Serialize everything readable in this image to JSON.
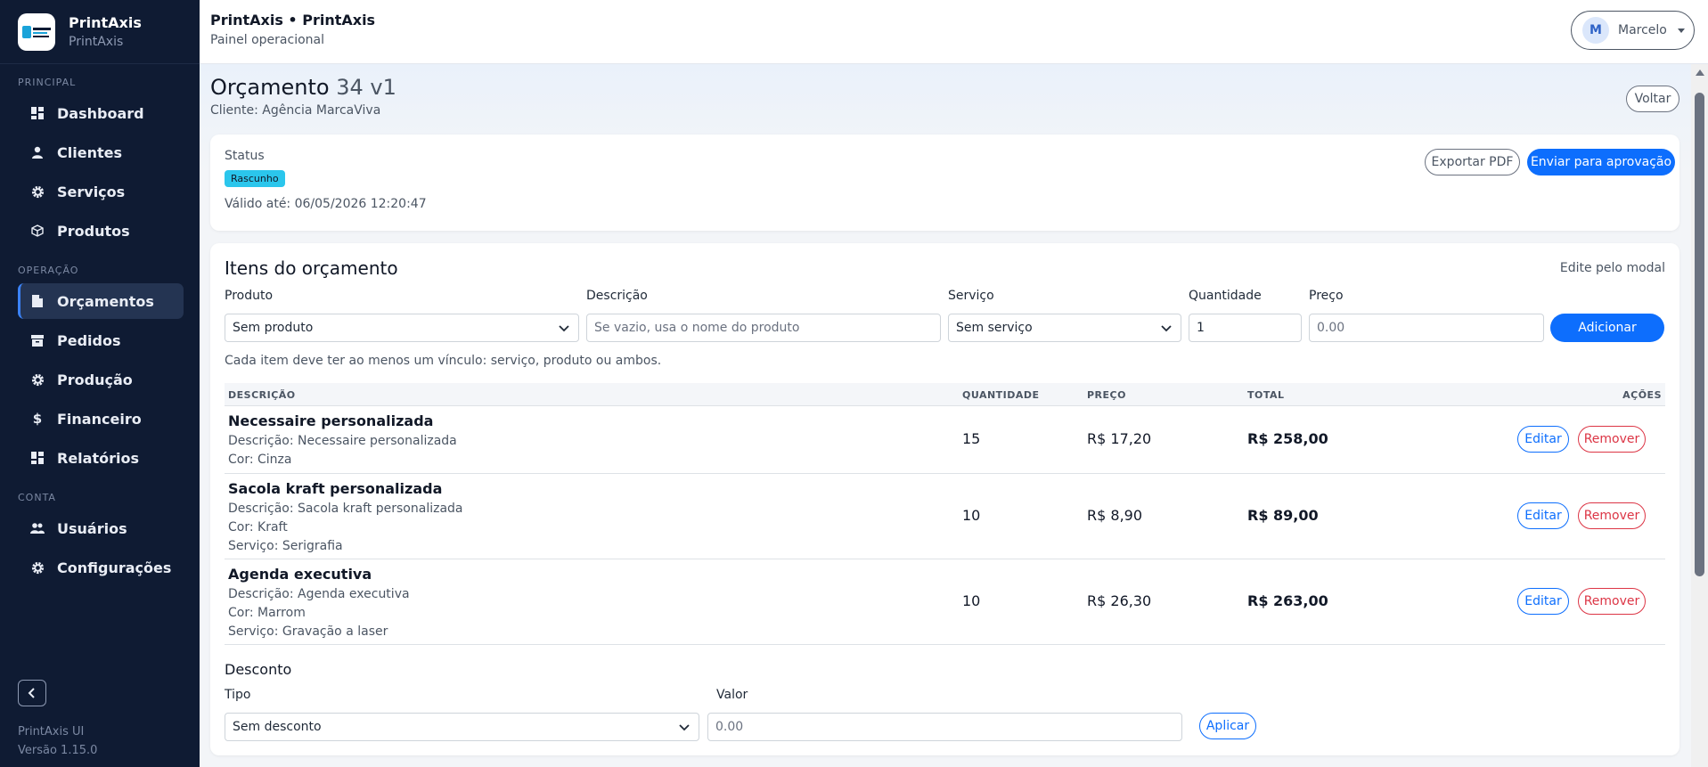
{
  "sidebar": {
    "brand_name": "PrintAxis",
    "brand_sub": "PrintAxis",
    "sections": [
      {
        "label": "PRINCIPAL",
        "items": [
          {
            "label": "Dashboard",
            "icon": "grid-icon"
          },
          {
            "label": "Clientes",
            "icon": "user-icon"
          },
          {
            "label": "Serviços",
            "icon": "gear-icon"
          },
          {
            "label": "Produtos",
            "icon": "box-icon"
          }
        ]
      },
      {
        "label": "OPERAÇÃO",
        "items": [
          {
            "label": "Orçamentos",
            "icon": "document-icon",
            "active": true
          },
          {
            "label": "Pedidos",
            "icon": "archive-icon"
          },
          {
            "label": "Produção",
            "icon": "gear-icon"
          },
          {
            "label": "Financeiro",
            "icon": "dollar-icon"
          },
          {
            "label": "Relatórios",
            "icon": "grid-icon"
          }
        ]
      },
      {
        "label": "CONTA",
        "items": [
          {
            "label": "Usuários",
            "icon": "users-icon"
          },
          {
            "label": "Configurações",
            "icon": "gear-icon"
          }
        ]
      }
    ],
    "footer_app": "PrintAxis UI",
    "footer_version": "Versão 1.15.0"
  },
  "header": {
    "title": "PrintAxis • PrintAxis",
    "subtitle": "Painel operacional",
    "user_initial": "M",
    "user_name": "Marcelo"
  },
  "page": {
    "title_prefix": "Orçamento",
    "title_number": "34 v1",
    "client": "Cliente: Agência MarcaViva",
    "back_label": "Voltar"
  },
  "status": {
    "label": "Status",
    "badge": "Rascunho",
    "valid_until": "Válido até: 06/05/2026 12:20:47",
    "export_label": "Exportar PDF",
    "send_label": "Enviar para aprovação",
    "badge_color": "#2bc6ec"
  },
  "items": {
    "title": "Itens do orçamento",
    "hint": "Edite pelo modal",
    "form": {
      "produto_label": "Produto",
      "produto_value": "Sem produto",
      "descricao_label": "Descrição",
      "descricao_placeholder": "Se vazio, usa o nome do produto",
      "servico_label": "Serviço",
      "servico_value": "Sem serviço",
      "quantidade_label": "Quantidade",
      "quantidade_value": "1",
      "preco_label": "Preço",
      "preco_placeholder": "0.00",
      "add_label": "Adicionar"
    },
    "rule_note": "Cada item deve ter ao menos um vínculo: serviço, produto ou ambos.",
    "columns": [
      "DESCRIÇÃO",
      "QUANTIDADE",
      "PREÇO",
      "TOTAL",
      "AÇÕES"
    ],
    "rows": [
      {
        "name": "Necessaire personalizada",
        "details": [
          "Descrição: Necessaire personalizada",
          "Cor: Cinza"
        ],
        "quantity": "15",
        "price": "R$ 17,20",
        "total": "R$ 258,00"
      },
      {
        "name": "Sacola kraft personalizada",
        "details": [
          "Descrição: Sacola kraft personalizada",
          "Cor: Kraft",
          "Serviço: Serigrafia"
        ],
        "quantity": "10",
        "price": "R$ 8,90",
        "total": "R$ 89,00"
      },
      {
        "name": "Agenda executiva",
        "details": [
          "Descrição: Agenda executiva",
          "Cor: Marrom",
          "Serviço: Gravação a laser"
        ],
        "quantity": "10",
        "price": "R$ 26,30",
        "total": "R$ 263,00"
      }
    ],
    "edit_label": "Editar",
    "remove_label": "Remover"
  },
  "discount": {
    "title": "Desconto",
    "tipo_label": "Tipo",
    "tipo_value": "Sem desconto",
    "valor_label": "Valor",
    "valor_placeholder": "0.00",
    "apply_label": "Aplicar"
  },
  "colors": {
    "sidebar_bg": "#0f1b33",
    "primary": "#0d6efd",
    "danger": "#dc3545"
  }
}
